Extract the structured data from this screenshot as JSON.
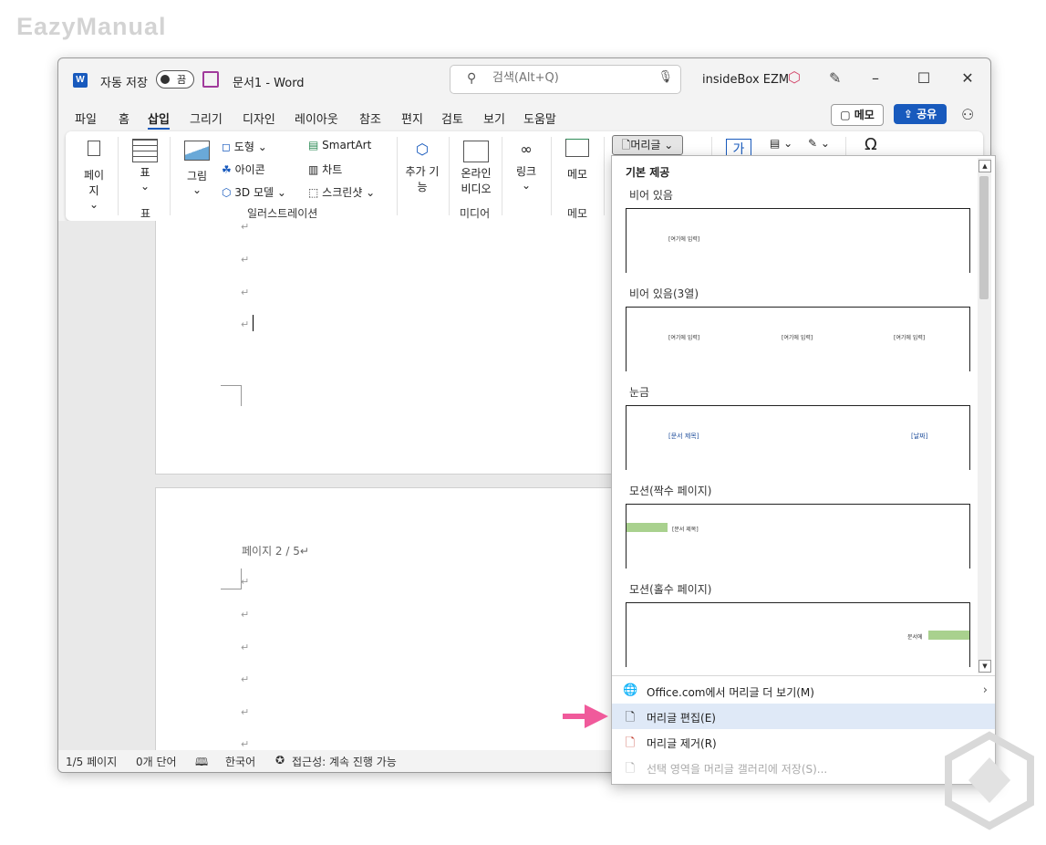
{
  "watermark": {
    "logo_text": "EazyManual"
  },
  "titlebar": {
    "app_icon": "W",
    "autosave_label": "자동 저장",
    "autosave_state": "끔",
    "doc_title": "문서1  -  Word",
    "search_placeholder": "검색(Alt+Q)",
    "user_name": "insideBox EZM",
    "minimize": "–",
    "maximize": "☐",
    "close": "✕"
  },
  "menu": {
    "tabs": [
      "파일",
      "홈",
      "삽입",
      "그리기",
      "디자인",
      "레이아웃",
      "참조",
      "편지",
      "검토",
      "보기",
      "도움말"
    ],
    "active_tab": "삽입",
    "memo_label": "메모",
    "share_label": "공유"
  },
  "ribbon": {
    "page_label": "페이지",
    "table_label": "표",
    "table_group": "표",
    "picture_label": "그림",
    "shapes_label": "도형",
    "icons_label": "아이콘",
    "model3d_label": "3D 모델",
    "smartart_label": "SmartArt",
    "chart_label": "차트",
    "screenshot_label": "스크린샷",
    "illustrations_group": "일러스트레이션",
    "addins_label_1": "추가 기",
    "addins_label_2": "능",
    "online_video_1": "온라인",
    "online_video_2": "비디오",
    "media_group": "미디어",
    "link_label": "링크",
    "comment_label": "메모",
    "comment_group": "메모",
    "header_label": "머리글",
    "textbox_glyph": "가",
    "symbol_glyph": "Ω"
  },
  "document": {
    "para_mark": "↵",
    "page2_header": "페이지 2 / 5↵"
  },
  "dropdown": {
    "section_title": "기본 제공",
    "items": [
      {
        "label": "비어 있음",
        "placeholders": [
          "[여기에 입력]"
        ]
      },
      {
        "label": "비어 있음(3열)",
        "placeholders": [
          "[여기에 입력]",
          "[여기에 입력]",
          "[여기에 입력]"
        ]
      },
      {
        "label": "눈금",
        "placeholders": [
          "[문서 제목]",
          "[날짜]"
        ]
      },
      {
        "label": "모션(짝수 페이지)",
        "placeholders": [
          "[문서 제목]"
        ]
      },
      {
        "label": "모션(홀수 페이지)",
        "placeholders": [
          "문서에"
        ]
      }
    ],
    "menu": [
      {
        "label": "Office.com에서 머리글 더 보기(M)",
        "icon": "globe-icon",
        "has_submenu": true
      },
      {
        "label": "머리글 편집(E)",
        "icon": "header-edit-icon",
        "highlighted": true
      },
      {
        "label": "머리글 제거(R)",
        "icon": "header-remove-icon"
      },
      {
        "label": "선택 영역을 머리글 갤러리에 저장(S)...",
        "icon": "header-save-icon",
        "disabled": true
      }
    ],
    "accent_green": "#a9d18e",
    "accent_blue": "#1f4e9b"
  },
  "statusbar": {
    "page": "1/5 페이지",
    "words": "0개 단어",
    "language": "한국어",
    "accessibility": "접근성: 계속 진행 가능"
  },
  "colors": {
    "brand": "#185abd",
    "arrow": "#f05a9b"
  }
}
